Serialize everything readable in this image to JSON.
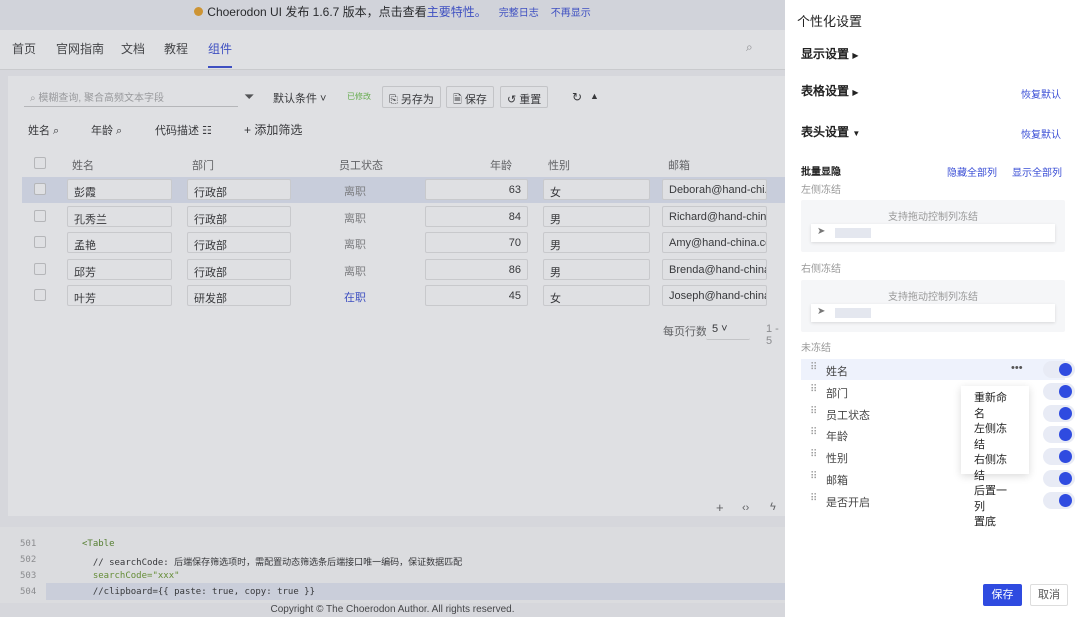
{
  "banner": {
    "text": "Choerodon UI 发布 1.6.7 版本，点击查看",
    "highlight": "主要特性。",
    "changelog": "完整日志",
    "dismiss": "不再显示"
  },
  "nav": {
    "tabs": [
      "首页",
      "官网指南",
      "文档",
      "教程",
      "组件"
    ],
    "active": "组件"
  },
  "toolbar": {
    "search_placeholder": "模糊查询, 聚合高频文本字段",
    "condition": "默认条件",
    "modified": "已修改",
    "save_as": "另存为",
    "save": "保存",
    "reset": "重置"
  },
  "filters": {
    "items": [
      "姓名",
      "年龄",
      "代码描述"
    ],
    "add": "添加筛选"
  },
  "table": {
    "headers": [
      "姓名",
      "部门",
      "员工状态",
      "年龄",
      "性别",
      "邮箱"
    ],
    "rows": [
      [
        "彭霞",
        "行政部",
        "离职",
        "63",
        "女",
        "Deborah@hand-chi..."
      ],
      [
        "孔秀兰",
        "行政部",
        "离职",
        "84",
        "男",
        "Richard@hand-chin..."
      ],
      [
        "孟艳",
        "行政部",
        "离职",
        "70",
        "男",
        "Amy@hand-china.co..."
      ],
      [
        "邱芳",
        "行政部",
        "离职",
        "86",
        "男",
        "Brenda@hand-china..."
      ],
      [
        "叶芳",
        "研发部",
        "在职",
        "45",
        "女",
        "Joseph@hand-china..."
      ]
    ]
  },
  "pagination": {
    "label": "每页行数:",
    "size": "5",
    "range": "1 - 5"
  },
  "code": {
    "lines": [
      {
        "n": "501",
        "t": "<Table"
      },
      {
        "n": "502",
        "t": "  // searchCode: 后端保存筛选项时，需配置动态筛选条后端接口唯一编码，保证数据匹配"
      },
      {
        "n": "503",
        "t": "  searchCode=\"xxx\""
      },
      {
        "n": "504",
        "t": "  //clipboard={{ paste: true, copy: true }}"
      }
    ]
  },
  "footer": "Copyright © The Choerodon Author. All rights reserved.",
  "drawer": {
    "title": "个性化设置",
    "display": "显示设置",
    "table": "表格设置",
    "header": "表头设置",
    "restore": "恢复默认",
    "batch": "批量显隐",
    "hide_all": "隐藏全部列",
    "show_all": "显示全部列",
    "left_freeze": "左侧冻结",
    "right_freeze": "右侧冻结",
    "unfrozen": "未冻结",
    "drag_tip": "支持拖动控制列冻结",
    "columns": [
      {
        "label": "姓名",
        "on": true
      },
      {
        "label": "部门",
        "on": true
      },
      {
        "label": "员工状态",
        "on": true
      },
      {
        "label": "年龄",
        "on": true
      },
      {
        "label": "性别",
        "on": true
      },
      {
        "label": "邮箱",
        "on": true
      },
      {
        "label": "是否开启",
        "on": true
      }
    ],
    "menu": [
      "重新命名",
      "左侧冻结",
      "右侧冻结",
      "后置一列",
      "置底"
    ],
    "save": "保存",
    "cancel": "取消"
  }
}
